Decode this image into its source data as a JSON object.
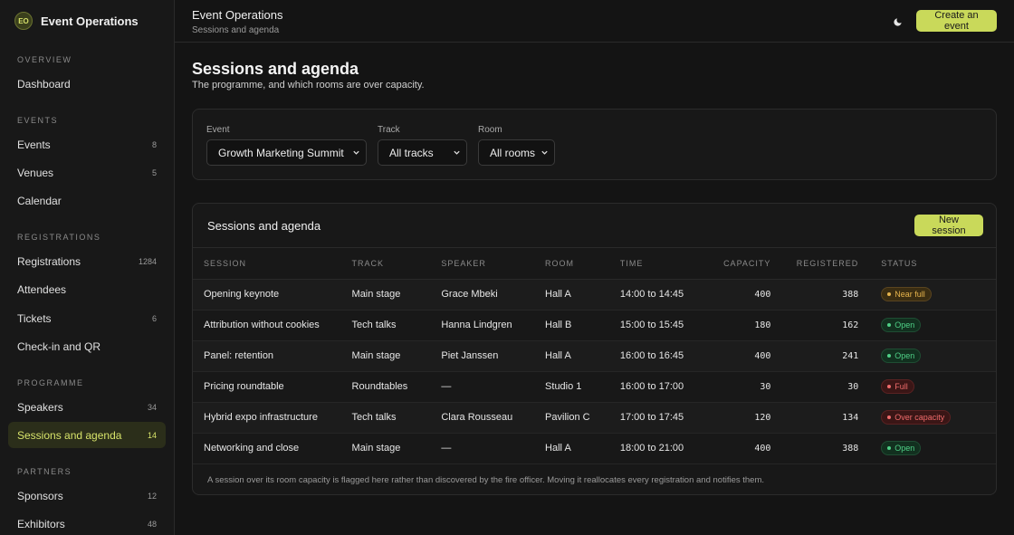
{
  "brand": {
    "logo": "EO",
    "name": "Event Operations"
  },
  "sidebar": {
    "sections": [
      {
        "heading": "OVERVIEW",
        "items": [
          {
            "label": "Dashboard",
            "count": ""
          }
        ]
      },
      {
        "heading": "EVENTS",
        "items": [
          {
            "label": "Events",
            "count": "8"
          },
          {
            "label": "Venues",
            "count": "5"
          },
          {
            "label": "Calendar",
            "count": ""
          }
        ]
      },
      {
        "heading": "REGISTRATIONS",
        "items": [
          {
            "label": "Registrations",
            "count": "1284"
          },
          {
            "label": "Attendees",
            "count": ""
          },
          {
            "label": "Tickets",
            "count": "6"
          },
          {
            "label": "Check-in and QR",
            "count": ""
          }
        ]
      },
      {
        "heading": "PROGRAMME",
        "items": [
          {
            "label": "Speakers",
            "count": "34"
          },
          {
            "label": "Sessions and agenda",
            "count": "14"
          }
        ]
      },
      {
        "heading": "PARTNERS",
        "items": [
          {
            "label": "Sponsors",
            "count": "12"
          },
          {
            "label": "Exhibitors",
            "count": "48"
          }
        ]
      }
    ],
    "active": "Sessions and agenda"
  },
  "topbar": {
    "title": "Event Operations",
    "subtitle": "Sessions and agenda",
    "theme_icon": "moon-icon",
    "create_label": "Create an event"
  },
  "page": {
    "title": "Sessions and agenda",
    "subtitle": "The programme, and which rooms are over capacity."
  },
  "filters": {
    "event": {
      "label": "Event",
      "value": "Growth Marketing Summit"
    },
    "track": {
      "label": "Track",
      "value": "All tracks"
    },
    "room": {
      "label": "Room",
      "value": "All rooms"
    }
  },
  "table": {
    "title": "Sessions and agenda",
    "new_label": "New session",
    "columns": [
      "SESSION",
      "TRACK",
      "SPEAKER",
      "ROOM",
      "TIME",
      "CAPACITY",
      "REGISTERED",
      "STATUS"
    ],
    "rows": [
      {
        "session": "Opening keynote",
        "track": "Main stage",
        "speaker": "Grace Mbeki",
        "room": "Hall A",
        "time": "14:00 to 14:45",
        "capacity": "400",
        "registered": "388",
        "status": "Near full",
        "status_kind": "near"
      },
      {
        "session": "Attribution without cookies",
        "track": "Tech talks",
        "speaker": "Hanna Lindgren",
        "room": "Hall B",
        "time": "15:00 to 15:45",
        "capacity": "180",
        "registered": "162",
        "status": "Open",
        "status_kind": "open"
      },
      {
        "session": "Panel: retention",
        "track": "Main stage",
        "speaker": "Piet Janssen",
        "room": "Hall A",
        "time": "16:00 to 16:45",
        "capacity": "400",
        "registered": "241",
        "status": "Open",
        "status_kind": "open"
      },
      {
        "session": "Pricing roundtable",
        "track": "Roundtables",
        "speaker": "—",
        "room": "Studio 1",
        "time": "16:00 to 17:00",
        "capacity": "30",
        "registered": "30",
        "status": "Full",
        "status_kind": "full"
      },
      {
        "session": "Hybrid expo infrastructure",
        "track": "Tech talks",
        "speaker": "Clara Rousseau",
        "room": "Pavilion C",
        "time": "17:00 to 17:45",
        "capacity": "120",
        "registered": "134",
        "status": "Over capacity",
        "status_kind": "over"
      },
      {
        "session": "Networking and close",
        "track": "Main stage",
        "speaker": "—",
        "room": "Hall A",
        "time": "18:00 to 21:00",
        "capacity": "400",
        "registered": "388",
        "status": "Open",
        "status_kind": "open"
      }
    ],
    "footnote": "A session over its room capacity is flagged here rather than discovered by the fire officer. Moving it reallocates every registration and notifies them."
  }
}
